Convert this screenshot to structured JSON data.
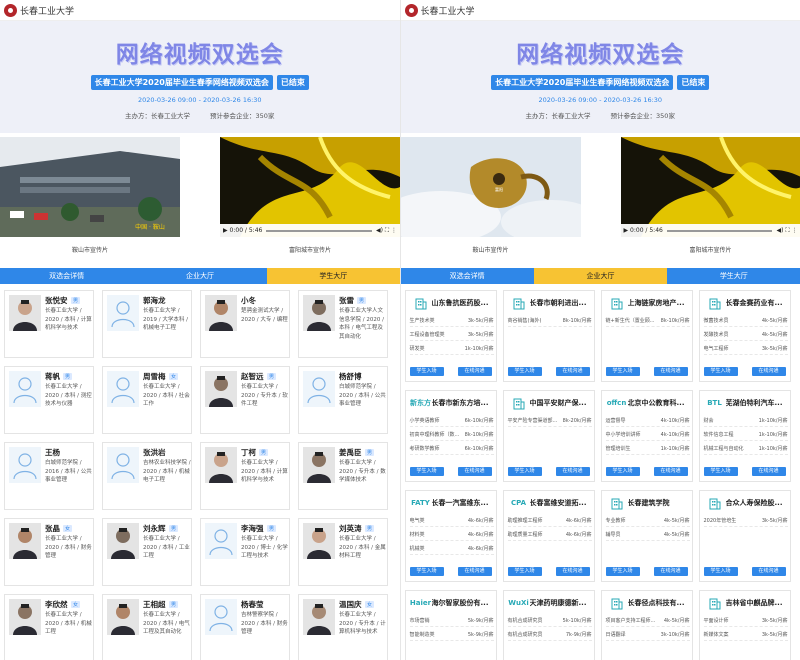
{
  "brand": "长春工业大学",
  "hero": {
    "title": "网络视频双选会",
    "subtitle": "长春工业大学2020届毕业生春季网络视频双选会",
    "status": "已结束",
    "date": "2020-03-26 09:00 - 2020-03-26 16:30",
    "organizer": "主办方：长春工业大学",
    "expected": "预计参会企业：350家"
  },
  "videos": {
    "left_caption": "鞍山市宣传片",
    "right_caption": "富阳城市宣传片",
    "time": "0:00 / 5:46"
  },
  "tabs": [
    "双选会详情",
    "企业大厅",
    "学生大厅"
  ],
  "students": [
    {
      "name": "张悦安",
      "gender": "男",
      "desc": "长春工业大学 / 2020 / 本科 / 计算机科学与技术",
      "photo": true
    },
    {
      "name": "郭海龙",
      "gender": "",
      "desc": "长春工业大学 / 2019 / 大学本科 / 机械电子工程",
      "photo": false
    },
    {
      "name": "小冬",
      "gender": "",
      "desc": "楚骋金测试大学 / 2020 / 大专 / 编程",
      "photo": true
    },
    {
      "name": "张雷",
      "gender": "男",
      "desc": "长春工业大学人文信息学院 / 2020 / 本科 / 电气工程及其自动化",
      "photo": true
    },
    {
      "name": "蒋帆",
      "gender": "男",
      "desc": "长春工业大学 / 2020 / 本科 / 测控技术与仪器",
      "photo": false
    },
    {
      "name": "周雪梅",
      "gender": "女",
      "desc": "长春工业大学 / 2020 / 本科 / 社会工作",
      "photo": false
    },
    {
      "name": "赵智远",
      "gender": "男",
      "desc": "长春工业大学 / 2020 / 专升本 / 软件工程",
      "photo": true
    },
    {
      "name": "杨舒博",
      "gender": "",
      "desc": "白城师范学院 / 2020 / 本科 / 公共事业管理",
      "photo": false
    },
    {
      "name": "王杨",
      "gender": "",
      "desc": "白城师范学院 / 2016 / 本科 / 公共事业管理",
      "photo": false
    },
    {
      "name": "张洪岩",
      "gender": "",
      "desc": "吉林农业科技学院 / 2020 / 本科 / 机械电子工程",
      "photo": false
    },
    {
      "name": "丁柯",
      "gender": "男",
      "desc": "长春工业大学 / 2020 / 本科 / 计算机科学与技术",
      "photo": true
    },
    {
      "name": "姜禹臣",
      "gender": "男",
      "desc": "长春工业大学 / 2020 / 专升本 / 数学媒体技术",
      "photo": true
    },
    {
      "name": "张晶",
      "gender": "女",
      "desc": "长春工业大学 / 2020 / 本科 / 财务管理",
      "photo": true
    },
    {
      "name": "刘永辉",
      "gender": "男",
      "desc": "长春工业大学 / 2020 / 本科 / 工业工程",
      "photo": true
    },
    {
      "name": "李海强",
      "gender": "男",
      "desc": "长春工业大学 / 2020 / 博士 / 化学工程与技术",
      "photo": false
    },
    {
      "name": "刘英涛",
      "gender": "男",
      "desc": "长春工业大学 / 2020 / 本科 / 金属材料工程",
      "photo": true
    },
    {
      "name": "李欣然",
      "gender": "女",
      "desc": "长春工业大学 / 2020 / 本科 / 机械工程",
      "photo": true
    },
    {
      "name": "王相超",
      "gender": "男",
      "desc": "长春工业大学 / 2020 / 本科 / 电气工程及其自动化",
      "photo": true
    },
    {
      "name": "杨春莹",
      "gender": "",
      "desc": "吉林警察学院 / 2020 / 本科 / 财务管理",
      "photo": false
    },
    {
      "name": "温国庆",
      "gender": "女",
      "desc": "长春工业大学 / 2020 / 专升本 / 计算机科学与技术",
      "photo": true
    }
  ],
  "companies": [
    {
      "name": "山东鲁抗医药股...",
      "logo": "",
      "jobs": [
        [
          "生产技术类",
          "3k-5k/月薪"
        ],
        [
          "工程设备管理类",
          "3k-5k/月薪"
        ],
        [
          "研发类",
          "1k-10k/月薪"
        ]
      ]
    },
    {
      "name": "长春市朝利进出...",
      "logo": "",
      "jobs": [
        [
          "商谷销售(海外)",
          "8k-10k/月薪"
        ]
      ]
    },
    {
      "name": "上海链家房地产...",
      "logo": "",
      "jobs": [
        [
          "链+新生代（置业顾...",
          "8k-10k/月薪"
        ]
      ]
    },
    {
      "name": "长春金赛药业有...",
      "logo": "",
      "jobs": [
        [
          "微菌技术员",
          "4k-5k/月薪"
        ],
        [
          "发酵技术员",
          "4k-5k/月薪"
        ],
        [
          "电气工程师",
          "3k-5k/月薪"
        ]
      ]
    },
    {
      "name": "长春市新东方培...",
      "logo": "新东方",
      "jobs": [
        [
          "小学英语教师",
          "6k-10k/月薪"
        ],
        [
          "初高中理科教师（数...",
          "8k-10k/月薪"
        ],
        [
          "考研数学教师",
          "6k-10k/月薪"
        ]
      ]
    },
    {
      "name": "中国平安财产保...",
      "logo": "",
      "jobs": [
        [
          "平安产险专营渠道部...",
          "8k-20k/月薪"
        ]
      ]
    },
    {
      "name": "北京中公教育科...",
      "logo": "offcn",
      "jobs": [
        [
          "运营督导",
          "4k-10k/月薪"
        ],
        [
          "中小学培训讲师",
          "4k-10k/月薪"
        ],
        [
          "管理培训生",
          "1k-10k/月薪"
        ]
      ]
    },
    {
      "name": "芜湖伯特利汽车...",
      "logo": "BTL",
      "jobs": [
        [
          "财会",
          "1k-10k/月薪"
        ],
        [
          "软件信息工程",
          "1k-10k/月薪"
        ],
        [
          "机械工程与自动化",
          "1k-10k/月薪"
        ]
      ]
    },
    {
      "name": "长春一汽富维东...",
      "logo": "FATY",
      "jobs": [
        [
          "电气类",
          "4k-6k/月薪"
        ],
        [
          "材料类",
          "4k-6k/月薪"
        ],
        [
          "机械类",
          "4k-6k/月薪"
        ]
      ]
    },
    {
      "name": "长春富维安道拓...",
      "logo": "CPA",
      "jobs": [
        [
          "助理推理工程师",
          "4k-6k/月薪"
        ],
        [
          "助理质量工程师",
          "4k-6k/月薪"
        ]
      ]
    },
    {
      "name": "长春建筑学院",
      "logo": "",
      "jobs": [
        [
          "专业教师",
          "4k-5k/月薪"
        ],
        [
          "辅导员",
          "4k-5k/月薪"
        ]
      ]
    },
    {
      "name": "合众人寿保险股...",
      "logo": "",
      "jobs": [
        [
          "2020年管培生",
          "3k-5k/月薪"
        ]
      ]
    },
    {
      "name": "海尔智家股份有...",
      "logo": "Haier",
      "jobs": [
        [
          "市场营销",
          "5k-9k/月薪"
        ],
        [
          "智能制造类",
          "5k-9k/月薪"
        ]
      ]
    },
    {
      "name": "天津药明康德新...",
      "logo": "WuXi",
      "jobs": [
        [
          "有机合成研究员",
          "5k-10k/月薪"
        ],
        [
          "有机合成研究员",
          "7k-9k/月薪"
        ]
      ]
    },
    {
      "name": "长春径点科技有...",
      "logo": "",
      "jobs": [
        [
          "项目客户支持工程师...",
          "4k-5k/月薪"
        ],
        [
          "日语翻译",
          "3k-10k/月薪"
        ]
      ]
    },
    {
      "name": "吉林省中麒品牌...",
      "logo": "",
      "jobs": [
        [
          "平面设计师",
          "3k-5k/月薪"
        ],
        [
          "新媒体文案",
          "3k-5k/月薪"
        ]
      ]
    }
  ],
  "company_buttons": {
    "enter": "学生入场",
    "chat": "在线沟通"
  },
  "colors": {
    "primary": "#2f87e8",
    "active_tab": "#f7c333",
    "hero_title": "#7f86e6"
  }
}
